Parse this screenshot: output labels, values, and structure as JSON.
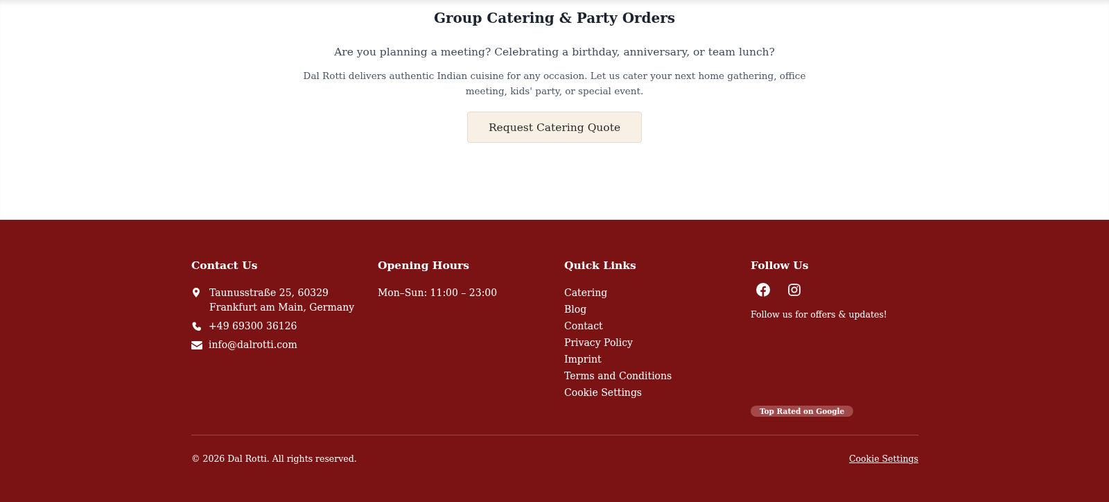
{
  "catering": {
    "title": "Group Catering & Party Orders",
    "question": "Are you planning a meeting? Celebrating a birthday, anniversary, or team lunch?",
    "description": "Dal Rotti delivers authentic Indian cuisine for any occasion. Let us cater your next home gathering, office meeting, kids' party, or special event.",
    "button": "Request Catering Quote"
  },
  "footer": {
    "contact": {
      "heading": "Contact Us",
      "items": [
        {
          "kind": "address",
          "lines": [
            "Taunusstraße 25, 60329",
            "Frankfurt am Main, Germany"
          ]
        },
        {
          "kind": "phone",
          "lines": [
            "+49 69300 36126"
          ]
        },
        {
          "kind": "email",
          "lines": [
            "info@dalrotti.com"
          ]
        }
      ]
    },
    "hours": {
      "heading": "Opening Hours",
      "lines": [
        "Mon–Sun: 11:00 – 23:00"
      ]
    },
    "quick_links": {
      "heading": "Quick Links",
      "links": [
        "Catering",
        "Blog",
        "Contact",
        "Privacy Policy",
        "Imprint",
        "Terms and Conditions",
        "Cookie Settings"
      ]
    },
    "follow": {
      "heading": "Follow Us",
      "socials": [
        {
          "kind": "facebook"
        },
        {
          "kind": "instagram"
        }
      ],
      "note": "Follow us for offers & updates!",
      "badge": "Top Rated on Google"
    },
    "copyright": "© 2026 Dal Rotti. All rights reserved.",
    "bottom_link": "Cookie Settings"
  }
}
